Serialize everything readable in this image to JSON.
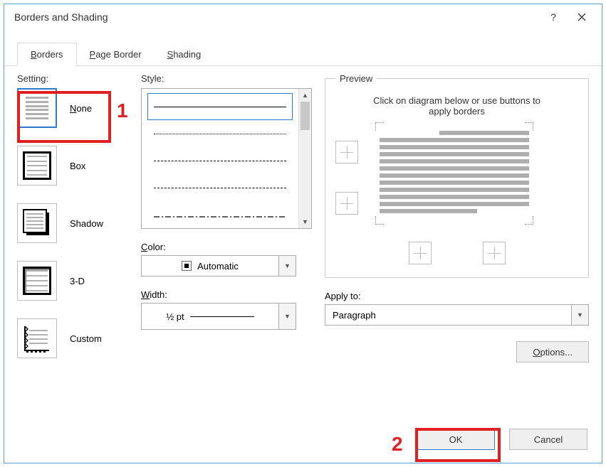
{
  "title": "Borders and Shading",
  "tabs": {
    "borders": {
      "prefix": "B",
      "rest": "orders"
    },
    "page_border": {
      "prefix": "P",
      "rest": "age Border"
    },
    "shading": {
      "prefix": "S",
      "rest": "hading"
    }
  },
  "labels": {
    "setting": "Setting:",
    "style": "Style:",
    "color": "Color:",
    "width": "Width:",
    "preview_legend": "Preview",
    "preview_text": "Click on diagram below or use buttons to apply borders",
    "apply_to": "Apply to:",
    "options": "Options...",
    "ok": "OK",
    "cancel": "Cancel"
  },
  "setting_items": {
    "none": {
      "prefix": "N",
      "rest": "one"
    },
    "box": "Box",
    "shadow": "Shadow",
    "threed": "3-D",
    "custom": "Custom"
  },
  "color_value": "Automatic",
  "width_value": "½ pt",
  "apply_to_value": "Paragraph",
  "markers": {
    "one": "1",
    "two": "2"
  }
}
